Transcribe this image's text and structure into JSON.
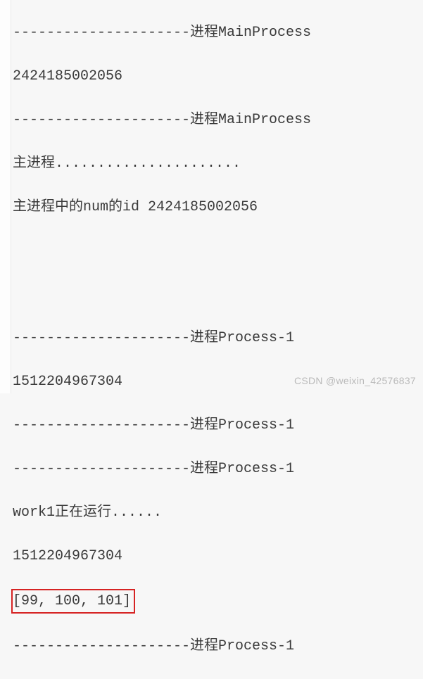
{
  "lines": {
    "l1": "---------------------进程MainProcess",
    "l2": "2424185002056",
    "l3": "---------------------进程MainProcess",
    "l4": "主进程......................",
    "l5": "主进程中的num的id 2424185002056",
    "l6": "",
    "l7": "",
    "l8": "---------------------进程Process-1",
    "l9": "1512204967304",
    "l10": "---------------------进程Process-1",
    "l11": "---------------------进程Process-1",
    "l12": "work1正在运行......",
    "l13": "1512204967304",
    "l14": "[99, 100, 101]",
    "l15": "---------------------进程Process-1"
  },
  "watermark": "CSDN @weixin_42576837"
}
